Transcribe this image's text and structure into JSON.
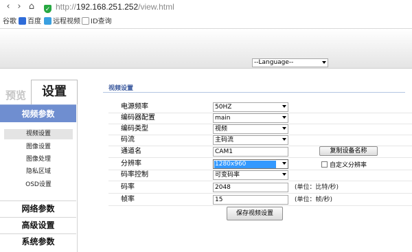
{
  "browser": {
    "url_scheme": "http://",
    "url_host": "192.168.251.252",
    "url_path": "/view.html",
    "bookmarks": [
      {
        "label": "谷歌",
        "icon": "none"
      },
      {
        "label": "百度",
        "icon": "baidu-paw-icon"
      },
      {
        "label": "远程视频",
        "icon": "video-icon"
      },
      {
        "label": "ID查询",
        "icon": "page-icon"
      }
    ]
  },
  "header": {
    "language_select": "--Language--"
  },
  "tabs": {
    "preview": "预览",
    "settings": "设置"
  },
  "sidebar": {
    "active_section": "视频参数",
    "sub_items": [
      "视频设置",
      "图像设置",
      "图像处理",
      "隐私区域",
      "OSD设置"
    ],
    "selected_sub_item": "视频设置",
    "sections": [
      "网络参数",
      "高级设置",
      "系统参数"
    ]
  },
  "content": {
    "title": "视频设置",
    "rows": [
      {
        "label": "电源频率",
        "type": "select",
        "value": "50HZ"
      },
      {
        "label": "编码器配置",
        "type": "select",
        "value": "main"
      },
      {
        "label": "编码类型",
        "type": "select",
        "value": "视频"
      },
      {
        "label": "码流",
        "type": "select",
        "value": "主码流"
      },
      {
        "label": "通道名",
        "type": "input",
        "value": "CAM1"
      },
      {
        "label": "分辨率",
        "type": "select",
        "value": "1280x960",
        "focused": true
      },
      {
        "label": "码率控制",
        "type": "select",
        "value": "可变码率"
      },
      {
        "label": "码率",
        "type": "input",
        "value": "2048",
        "unit": "(单位：比特/秒)"
      },
      {
        "label": "帧率",
        "type": "input",
        "value": "15",
        "unit": "(单位：帧/秒)"
      }
    ],
    "copy_name_button": "复制设备名称",
    "custom_resolution_label": "自定义分辨率",
    "custom_resolution_checked": false,
    "save_button": "保存视频设置"
  },
  "colors": {
    "accent": "#6f8ed0",
    "title": "#3c5a9e",
    "focus_highlight": "#3399ff",
    "secure_icon": "#27a842"
  }
}
